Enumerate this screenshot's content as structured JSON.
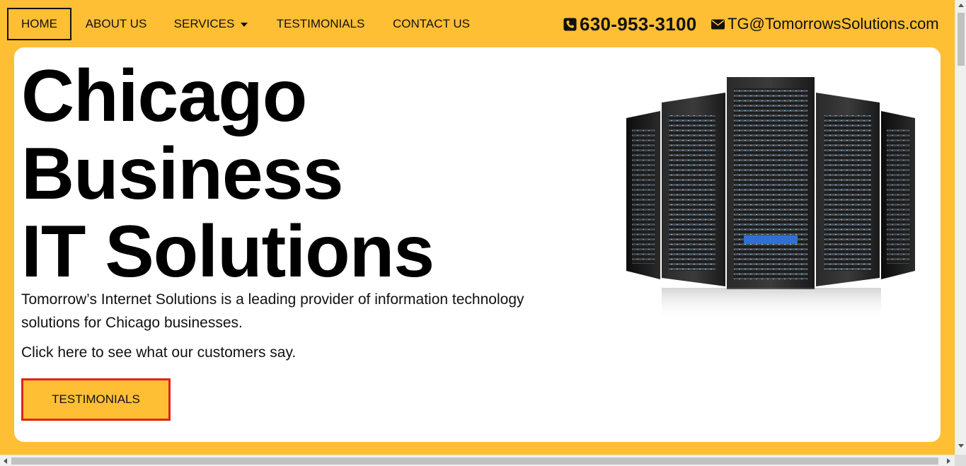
{
  "nav": {
    "home": "HOME",
    "about": "ABOUT US",
    "services": "SERVICES",
    "testimonials": "TESTIMONIALS",
    "contact": "CONTACT US"
  },
  "contact": {
    "phone": "630-953-3100",
    "email": "TG@TomorrowsSolutions.com"
  },
  "hero": {
    "title_lines": [
      "Chicago",
      "Business",
      "IT Solutions"
    ],
    "description": "Tomorrow’s Internet Solutions is a leading provider of information technology solutions for Chicago businesses.",
    "cta_text": "Click here to see what our customers say.",
    "button_label": "TESTIMONIALS"
  },
  "colors": {
    "brand_yellow": "#FFBF35",
    "button_border": "#E2231A"
  },
  "icons": {
    "phone": "phone-icon",
    "email": "envelope-icon",
    "services_dropdown": "caret-down-icon",
    "hero_image": "server-racks-image"
  }
}
